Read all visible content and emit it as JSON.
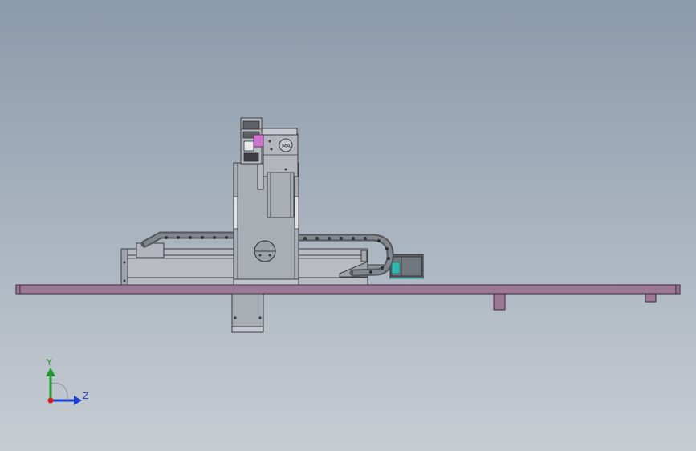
{
  "view": {
    "background_top": "#8b9aab",
    "background_bottom": "#c7ccd2"
  },
  "model": {
    "base_plate_color": "#9c7896",
    "body_color": "#a9adb4",
    "dark_color": "#55585e",
    "chain_color": "#6d7178",
    "motor_accent_color": "#2fb7b0",
    "spindle_accent_color": "#c874c8"
  },
  "triad": {
    "y_label": "Y",
    "z_label": "Z",
    "y_color": "#1f9a2e",
    "z_color": "#1d3fd1",
    "origin_color": "#d21f1f"
  }
}
